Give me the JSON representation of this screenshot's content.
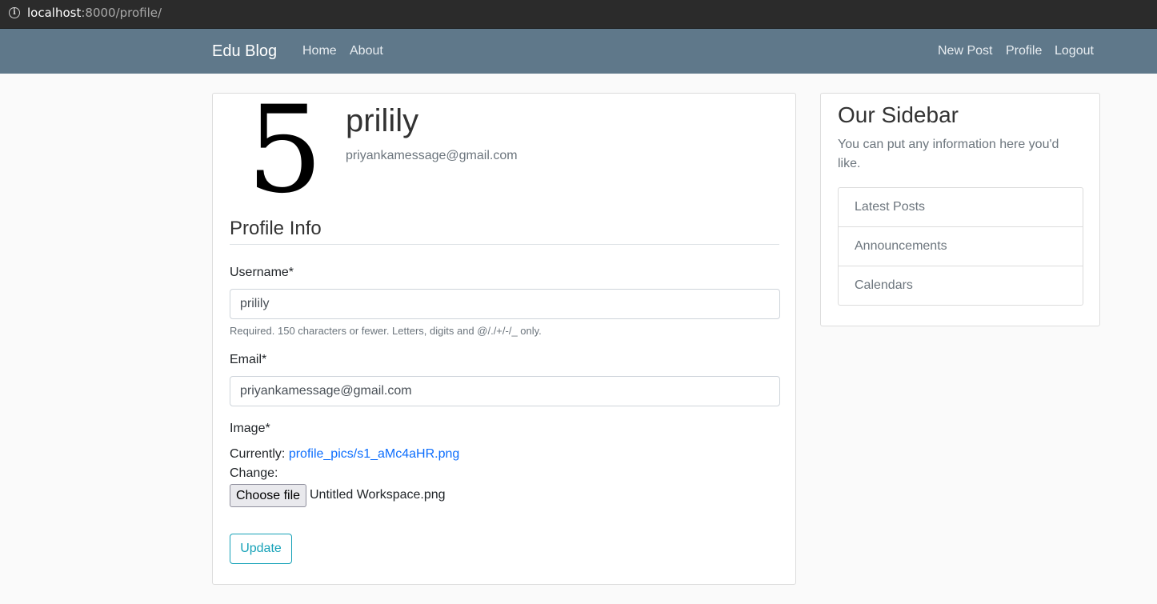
{
  "browser": {
    "url_host": "localhost",
    "url_rest": ":8000/profile/",
    "info_icon": "info-icon"
  },
  "navbar": {
    "brand": "Edu Blog",
    "left_links": [
      "Home",
      "About"
    ],
    "right_links": [
      "New Post",
      "Profile",
      "Logout"
    ],
    "color": "#5f788a"
  },
  "profile": {
    "avatar_text": "5",
    "username": "prilily",
    "email": "priyankamessage@gmail.com"
  },
  "form": {
    "legend": "Profile Info",
    "username_label": "Username*",
    "username_value": "prilily",
    "username_help": "Required. 150 characters or fewer. Letters, digits and @/./+/-/_ only.",
    "email_label": "Email*",
    "email_value": "priyankamessage@gmail.com",
    "image_label": "Image*",
    "currently_label": "Currently:",
    "current_image": "profile_pics/s1_aMc4aHR.png",
    "change_label": "Change:",
    "choose_file_label": "Choose file",
    "selected_file": "Untitled Workspace.png",
    "submit_label": "Update",
    "accent": "#17a2b8"
  },
  "sidebar": {
    "title": "Our Sidebar",
    "text": "You can put any information here you'd like.",
    "items": [
      "Latest Posts",
      "Announcements",
      "Calendars"
    ]
  }
}
